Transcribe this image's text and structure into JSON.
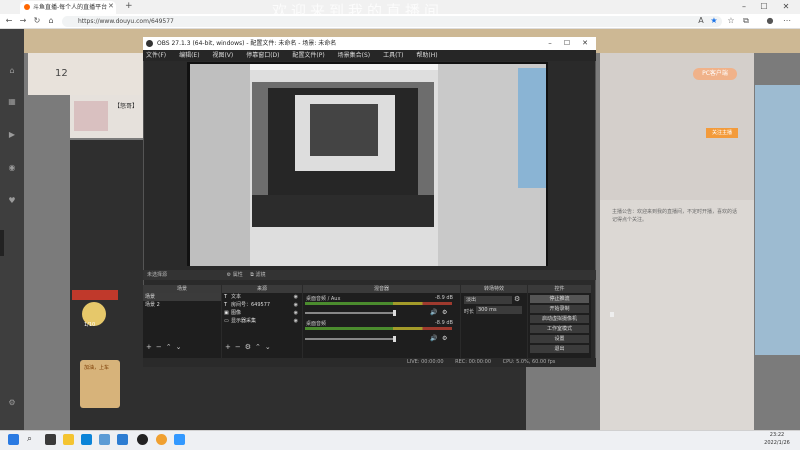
{
  "browser": {
    "tab_title": "斗鱼直播-每个人的直播平台",
    "url": "https://www.douyu.com/649577",
    "new_tab": "+",
    "overlay_text": "欢迎来到我的直播间"
  },
  "page": {
    "level_number": "12",
    "room_title": "【怒哥】",
    "gift_label": "1/10",
    "gift2_label": "加油，上车",
    "pc_button": "PC客户端",
    "follow_button": "关注主播",
    "right_text": "主播公告：欢迎来到我的直播间，不定时开播，喜欢的话记得点个关注。"
  },
  "obs": {
    "title": "OBS 27.1.3 (64-bit, windows) - 配置文件: 未命名 - 场景: 未命名",
    "menu": [
      "文件(F)",
      "编辑(E)",
      "视图(V)",
      "停靠窗口(D)",
      "配置文件(P)",
      "场景集合(S)",
      "工具(T)",
      "帮助(H)"
    ],
    "control_bar": {
      "no_source": "未选择源",
      "properties": "属性",
      "filters": "滤镜"
    },
    "docks": {
      "scenes": "场景",
      "sources": "来源",
      "mixer": "混音器",
      "transitions": "转场特效",
      "controls": "控件"
    },
    "scenes": [
      "场景",
      "场景 2"
    ],
    "sources": [
      "文本",
      "房间号：649577",
      "图像",
      "显示器采集"
    ],
    "mixer": [
      {
        "name": "桌面音频 / Aux",
        "db": "-8.9 dB"
      },
      {
        "name": "桌面音频",
        "db": "-8.9 dB"
      }
    ],
    "transition": {
      "type": "淡出",
      "duration_label": "时长",
      "duration": "300 ms"
    },
    "controls": [
      "停止推流",
      "开始录制",
      "启动虚拟摄像机",
      "工作室模式",
      "设置",
      "退出"
    ],
    "status": {
      "live": "LIVE: 00:00:00",
      "rec": "REC: 00:00:00",
      "cpu": "CPU: 5.0%, 60.00 fps"
    }
  },
  "taskbar": {
    "time": "23:22",
    "date": "2022/1/26"
  },
  "colors": {
    "accent": "#f39b3b",
    "obs_bg": "#2a2a2a"
  }
}
